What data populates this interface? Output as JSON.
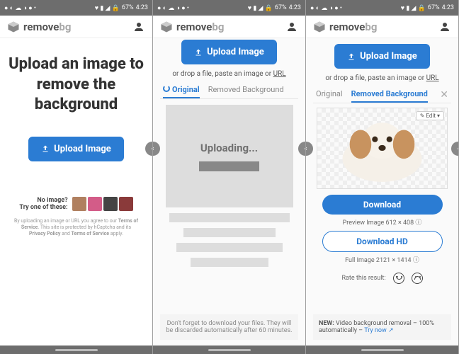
{
  "statusbar": {
    "battery": "67%",
    "time": "4:23"
  },
  "brand": {
    "name": "remove",
    "suffix": "bg"
  },
  "panel1": {
    "hero": "Upload an image to remove the background",
    "upload": "Upload Image",
    "noimg_l1": "No image?",
    "noimg_l2": "Try one of these:",
    "tos_pre": "By uploading an image or URL you agree to our ",
    "tos_terms": "Terms of Service",
    "tos_mid": ". This site is protected by hCaptcha and its ",
    "tos_pp": "Privacy Policy",
    "tos_and": " and ",
    "tos_tos2": "Terms of Service",
    "tos_end": " apply."
  },
  "panel2": {
    "upload": "Upload Image",
    "drop": "or drop a file, paste an image or ",
    "url": "URL",
    "tab_original": "Original",
    "tab_removed": "Removed Background",
    "uploading": "Uploading...",
    "notice": "Don't forget to download your files. They will be discarded automatically after 60 minutes."
  },
  "panel3": {
    "upload": "Upload Image",
    "drop": "or drop a file, paste an image or ",
    "url": "URL",
    "tab_original": "Original",
    "tab_removed": "Removed Background",
    "edit": "Edit",
    "download": "Download",
    "preview": "Preview Image 612 × 408",
    "downloadhd": "Download HD",
    "full": "Full Image 2121 × 1414",
    "rate": "Rate this result:",
    "banner_new": "NEW:",
    "banner_txt": " Video background removal – 100% automatically – ",
    "banner_link": "Try now"
  }
}
